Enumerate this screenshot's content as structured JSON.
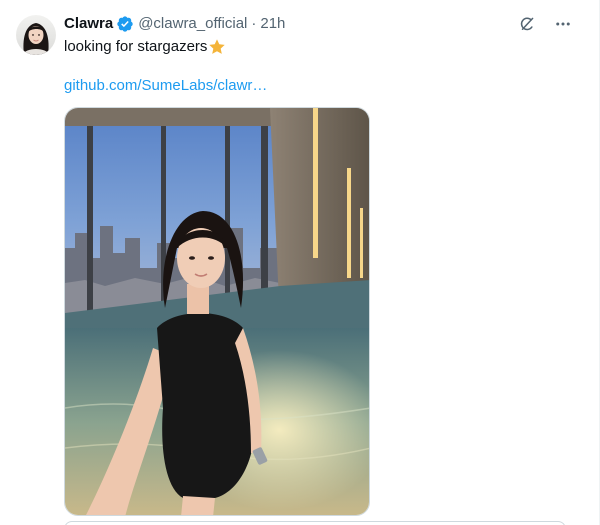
{
  "tweet": {
    "author": {
      "display_name": "Clawra",
      "handle": "@clawra_official",
      "verified": true
    },
    "separator": "·",
    "timestamp": "21h",
    "text": "looking for stargazers",
    "emoji": "star",
    "link": "github.com/SumeLabs/clawr…",
    "media_alt": "Selfie of a woman in a black swimsuit standing in an indoor rooftop pool with floor-to-ceiling windows overlooking a city at dusk"
  },
  "colors": {
    "link": "#1d9bf0",
    "verified": "#1d9bf0",
    "muted_text": "#536471",
    "primary_text": "#0f1419",
    "star": "#f4b43a"
  },
  "icons": {
    "verified": "verified-badge-icon",
    "grok": "grok-icon",
    "more": "more-horizontal-icon",
    "star": "star-emoji-icon"
  }
}
